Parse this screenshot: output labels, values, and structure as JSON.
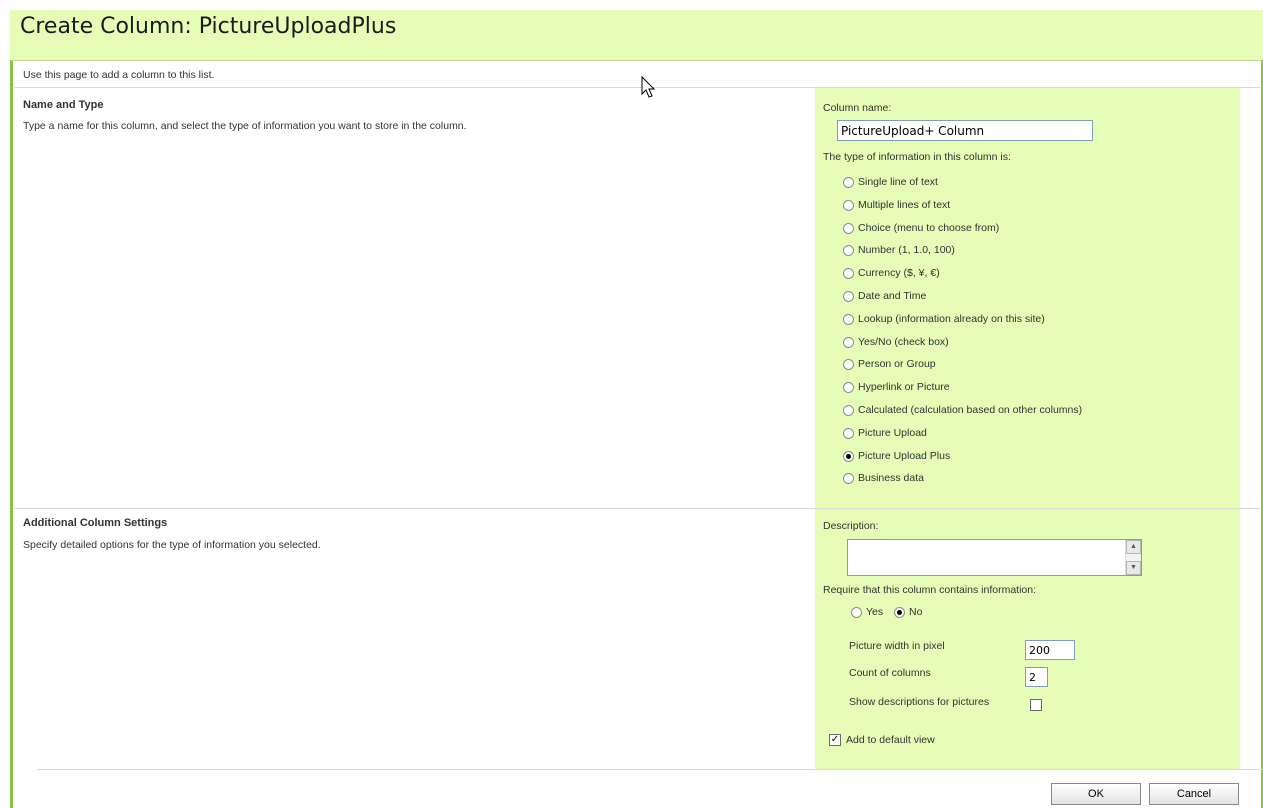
{
  "page": {
    "title": "Create Column: PictureUploadPlus",
    "intro": "Use this page to add a column to this list."
  },
  "name_and_type": {
    "heading": "Name and Type",
    "description": "Type a name for this column, and select the type of information you want to store in the column.",
    "column_name_label": "Column name:",
    "column_name_value": "PictureUpload+ Column",
    "type_label": "The type of information in this column is:",
    "types": [
      {
        "label": "Single line of text",
        "checked": false
      },
      {
        "label": "Multiple lines of text",
        "checked": false
      },
      {
        "label": "Choice (menu to choose from)",
        "checked": false
      },
      {
        "label": "Number (1, 1.0, 100)",
        "checked": false
      },
      {
        "label": "Currency ($, ¥, €)",
        "checked": false
      },
      {
        "label": "Date and Time",
        "checked": false
      },
      {
        "label": "Lookup (information already on this site)",
        "checked": false
      },
      {
        "label": "Yes/No (check box)",
        "checked": false
      },
      {
        "label": "Person or Group",
        "checked": false
      },
      {
        "label": "Hyperlink or Picture",
        "checked": false
      },
      {
        "label": "Calculated (calculation based on other columns)",
        "checked": false
      },
      {
        "label": "Picture Upload",
        "checked": false
      },
      {
        "label": "Picture Upload Plus",
        "checked": true
      },
      {
        "label": "Business data",
        "checked": false
      }
    ]
  },
  "additional": {
    "heading": "Additional Column Settings",
    "description": "Specify detailed options for the type of information you selected.",
    "description_label": "Description:",
    "description_value": "",
    "require_label": "Require that this column contains information:",
    "require_yes": "Yes",
    "require_no": "No",
    "require_selected": "No",
    "picture_width_label": "Picture width in pixel",
    "picture_width_value": "200",
    "count_columns_label": "Count of columns",
    "count_columns_value": "2",
    "show_desc_label": "Show descriptions for pictures",
    "show_desc_checked": false,
    "add_default_label": "Add to default view",
    "add_default_checked": true
  },
  "buttons": {
    "ok": "OK",
    "cancel": "Cancel"
  },
  "icons": {
    "cursor": "mouse-pointer-icon",
    "scroll_up": "arrow-up-icon",
    "scroll_down": "arrow-down-icon",
    "checkmark": "check-icon"
  },
  "colors": {
    "accent_green": "#8ac43f",
    "panel_green": "#e5fdb6"
  }
}
